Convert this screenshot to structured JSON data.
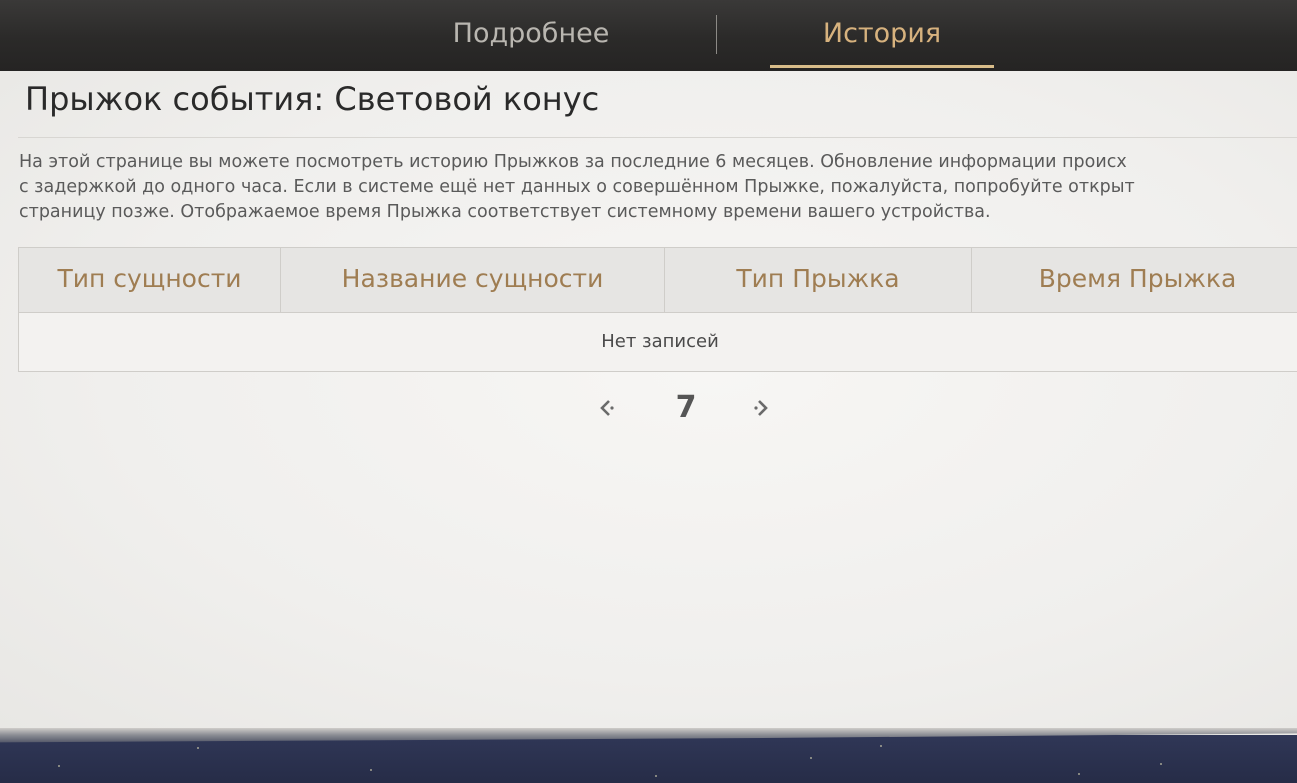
{
  "tabs": [
    {
      "label": "Подробнее",
      "active": false
    },
    {
      "label": "История",
      "active": true
    }
  ],
  "page": {
    "title": "Прыжок события: Световой конус",
    "description_lines": [
      "На этой странице вы можете посмотреть историю Прыжков за последние 6 месяцев. Обновление информации происх",
      "с задержкой до одного часа. Если в системе ещё нет данных о совершённом Прыжке, пожалуйста, попробуйте открыт",
      "страницу позже. Отображаемое время Прыжка соответствует системному времени вашего устройства."
    ]
  },
  "table": {
    "headers": [
      "Тип сущности",
      "Название сущности",
      "Тип Прыжка",
      "Время Прыжка"
    ],
    "empty_text": "Нет записей"
  },
  "pagination": {
    "current_page": "7",
    "prev_icon": "chevron-left-icon",
    "next_icon": "chevron-right-icon"
  },
  "colors": {
    "active_tab": "#d7b27e",
    "header_text": "#9f7d52",
    "topbar": "#2b2a29"
  }
}
